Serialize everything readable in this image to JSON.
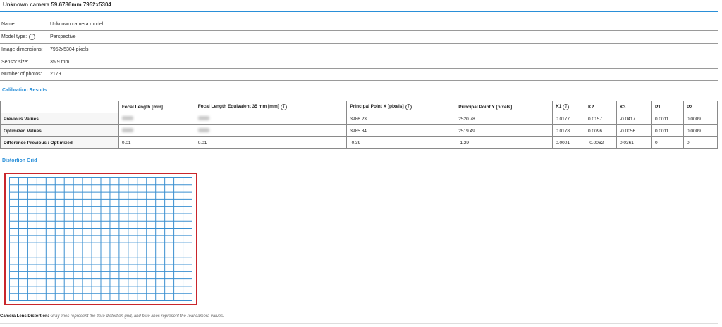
{
  "header": {
    "title": "Unknown camera 59.6786mm 7952x5304"
  },
  "properties": [
    {
      "label": "Name:",
      "value": "Unknown camera model",
      "info": false
    },
    {
      "label": "Model type:",
      "value": "Perspective",
      "info": true
    },
    {
      "label": "Image dimensions:",
      "value": "7952x5304 pixels",
      "info": false
    },
    {
      "label": "Sensor size:",
      "value": "35.9 mm",
      "info": false
    },
    {
      "label": "Number of photos:",
      "value": "2179",
      "info": false
    }
  ],
  "calibration": {
    "section_title": "Calibration Results",
    "columns": [
      {
        "label": "Focal Length [mm]",
        "info": false
      },
      {
        "label": "Focal Length Equivalent 35 mm [mm]",
        "info": true
      },
      {
        "label": "Principal Point X [pixels]",
        "info": true
      },
      {
        "label": "Principal Point Y [pixels]",
        "info": false
      },
      {
        "label": "K1",
        "info": true
      },
      {
        "label": "K2",
        "info": false
      },
      {
        "label": "K3",
        "info": false
      },
      {
        "label": "P1",
        "info": false
      },
      {
        "label": "P2",
        "info": false
      }
    ],
    "rows": [
      {
        "label": "Previous Values",
        "cells": [
          "",
          "",
          "3986.23",
          "2520.78",
          "0.0177",
          "0.0157",
          "-0.0417",
          "0.0011",
          "0.0009"
        ]
      },
      {
        "label": "Optimized Values",
        "cells": [
          "",
          "",
          "3985.84",
          "2519.49",
          "0.0178",
          "0.0096",
          "-0.0056",
          "0.0011",
          "0.0009"
        ]
      },
      {
        "label": "Difference Previous / Optimized",
        "cells": [
          "0.01",
          "0.01",
          "-0.39",
          "-1.29",
          "0.0001",
          "-0.0062",
          "0.0361",
          "0",
          "0"
        ]
      }
    ]
  },
  "distortion": {
    "section_title": "Distortion Grid",
    "grid_color": "#3a8fd0",
    "border_color": "#c9262c",
    "columns": 20,
    "rows": 17
  },
  "caption": {
    "label": "Camera Lens Distortion:",
    "text": "Gray lines represent the zero distortion grid, and blue lines represent the real camera values."
  },
  "colors": {
    "accent": "#2a8fd8"
  }
}
